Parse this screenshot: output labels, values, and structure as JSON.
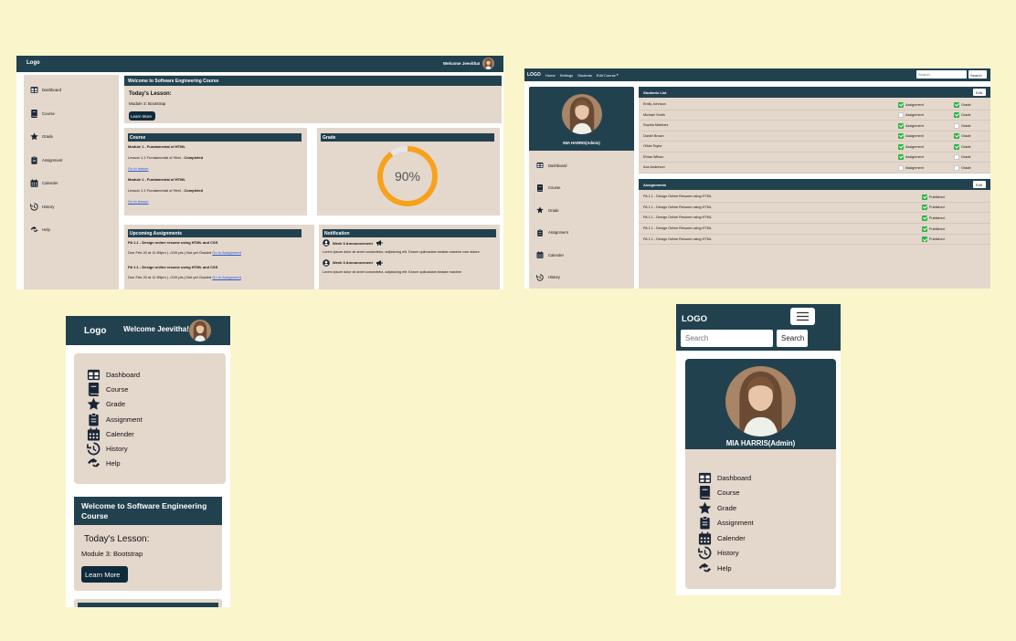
{
  "colors": {
    "page_bg": "#fbf5cc",
    "header": "#22414f",
    "panel": "#e4d7cc",
    "accent": "#f7a21b",
    "check": "#2fb344"
  },
  "desktop": {
    "logo": "Logo",
    "welcome": "Welcome Jeevitha!",
    "sidebar": [
      {
        "icon": "table-icon",
        "label": "Dashboard"
      },
      {
        "icon": "book-icon",
        "label": "Course"
      },
      {
        "icon": "star-icon",
        "label": "Grade"
      },
      {
        "icon": "clipboard-icon",
        "label": "Assignment"
      },
      {
        "icon": "calendar-icon",
        "label": "Calender"
      },
      {
        "icon": "history-icon",
        "label": "History"
      },
      {
        "icon": "handshake-icon",
        "label": "Help"
      }
    ],
    "welcome_card": {
      "title": "Welcome to Software Engineering Course",
      "lesson_heading": "Today's Lesson:",
      "lesson": "Module 3: Bootstrap",
      "button": "Learn More"
    },
    "course": {
      "title": "Course",
      "items": [
        {
          "module": "Module 1 - Fundamental of HTML",
          "lesson": "Lesson 1.1 Fundamental of Html - ",
          "status": "Completed",
          "link": "Go to lesson"
        },
        {
          "module": "Module 1 - Fundamental of HTML",
          "lesson": "Lesson 1.1 Fundamental of Html - ",
          "status": "Completed",
          "link": "Go to lesson"
        }
      ]
    },
    "grade": {
      "title": "Grade",
      "percent_label": "90%",
      "percent": 90
    },
    "assignments": {
      "title": "Upcoming Assignments",
      "items": [
        {
          "title": "PA 1.1 - Design online resume using HTML and CSS",
          "due": "Due Feb 20 at 11:59pm | -/100 pts-| Not yet Graded ",
          "link": "Go to Assignment"
        },
        {
          "title": "PA 1.1 - Design online resume using HTML and CSS",
          "due": "Due Feb 20 at 11:59pm | -/100 pts-| Not yet Graded ",
          "link": "Go to Assignment"
        }
      ]
    },
    "notification": {
      "title": "Notification",
      "items": [
        {
          "title": "Week 3 Announcement",
          "body": "Lorem ipsum dolor sit amet consectetur, adipisicing elit. Earum quibusdam beatae maxime cum dolore."
        },
        {
          "title": "Week 3 Announcement",
          "body": "Lorem ipsum dolor sit amet consectetur, adipisicing elit. Earum quibusdam beatae maxime"
        }
      ]
    }
  },
  "admin": {
    "logo": "LOGO",
    "nav": [
      "Home",
      "Settings",
      "Students",
      "Edit Course"
    ],
    "search_placeholder": "Search",
    "search_button": "Search",
    "profile_name": "MIA HARRIS(Admin)",
    "sidebar": [
      "Dashboard",
      "Course",
      "Grade",
      "Assignment",
      "Calender",
      "History"
    ],
    "students": {
      "title": "Students List",
      "edit": "Edit",
      "col_assignment": "Assignment",
      "col_grade": "Grade",
      "rows": [
        {
          "name": "Emily Johnson",
          "assignment": true,
          "grade": true
        },
        {
          "name": "Michael Smith",
          "assignment": false,
          "grade": true
        },
        {
          "name": "Sophia Martinez",
          "assignment": true,
          "grade": false
        },
        {
          "name": "Daniel Brown",
          "assignment": true,
          "grade": true
        },
        {
          "name": "Olivia Taylor",
          "assignment": true,
          "grade": true
        },
        {
          "name": "Ethan Wilson",
          "assignment": true,
          "grade": false
        },
        {
          "name": "Ava Anderson",
          "assignment": false,
          "grade": false
        }
      ]
    },
    "assignments": {
      "title": "Assignments",
      "edit": "Edit",
      "status": "Published",
      "rows": [
        "PA 1.1 - Design Online Resume using HTML",
        "PA 1.1 - Design Online Resume using HTML",
        "PA 1.1 - Design Online Resume using HTML",
        "PA 1.1 - Design Online Resume using HTML",
        "PA 1.1 - Design Online Resume using HTML"
      ]
    }
  },
  "mobile_student": {
    "logo": "Logo",
    "welcome": "Welcome Jeevitha!",
    "sidebar": [
      "Dashboard",
      "Course",
      "Grade",
      "Assignment",
      "Calender",
      "History",
      "Help"
    ],
    "card_title": "Welcome to Software Engineering Course",
    "lesson_heading": "Today's Lesson:",
    "lesson": "Module 3: Bootstrap",
    "button": "Learn More"
  },
  "mobile_admin": {
    "logo": "LOGO",
    "search_placeholder": "Search",
    "search_button": "Search",
    "profile_name": "MIA HARRIS(Admin)",
    "sidebar": [
      "Dashboard",
      "Course",
      "Grade",
      "Assignment",
      "Calender",
      "History",
      "Help"
    ]
  }
}
